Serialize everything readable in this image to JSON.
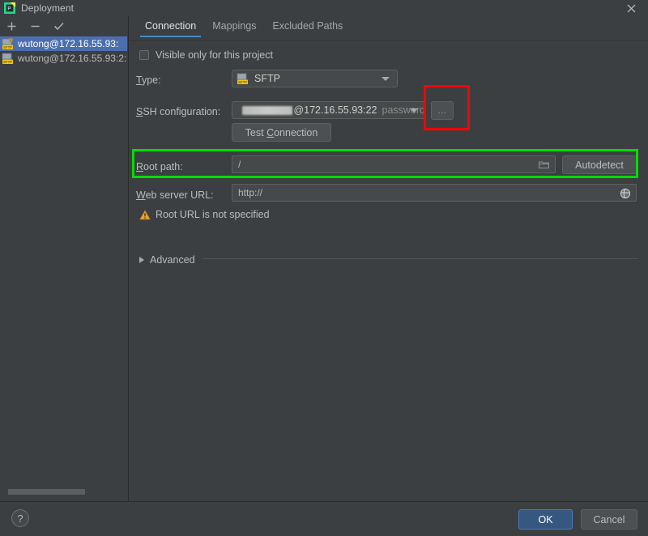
{
  "window": {
    "title": "Deployment",
    "app_icon": "pycharm-icon",
    "close_icon": "close-icon"
  },
  "sidebar": {
    "toolbar": [
      {
        "name": "add-server-button",
        "icon": "plus-icon",
        "label": "+"
      },
      {
        "name": "remove-server-button",
        "icon": "minus-icon",
        "label": "−"
      },
      {
        "name": "set-default-server-button",
        "icon": "check-icon",
        "label": "✓"
      }
    ],
    "servers": [
      {
        "label": "wutong@172.16.55.93:",
        "icon": "sftp-warning-icon",
        "selected": true
      },
      {
        "label": "wutong@172.16.55.93:2:",
        "icon": "sftp-icon",
        "selected": false
      }
    ],
    "scrollbar": "horizontal-scrollbar"
  },
  "tabs": [
    {
      "label": "Connection",
      "active": true
    },
    {
      "label": "Mappings",
      "active": false
    },
    {
      "label": "Excluded Paths",
      "active": false
    }
  ],
  "form": {
    "visible_only_checkbox": {
      "label": "Visible only for this project",
      "checked": false
    },
    "type": {
      "label": "Type:",
      "label_mnemonic": "T",
      "value": "SFTP",
      "icon": "sftp-icon",
      "dropdown_icon": "chevron-down-icon"
    },
    "ssh_configuration": {
      "label": "SSH configuration:",
      "label_mnemonic": "S",
      "value_redacted": true,
      "value_suffix": "@172.16.55.93:22",
      "auth_hint": "password",
      "dropdown_icon": "chevron-down-icon",
      "browse_button_label": "...",
      "browse_button_highlight": "red"
    },
    "test_connection_button": {
      "label": "Test Connection",
      "label_mnemonic": "C"
    },
    "root_path": {
      "label": "Root path:",
      "label_mnemonic": "R",
      "value": "/",
      "folder_icon": "folder-icon",
      "autodetect_label": "Autodetect",
      "row_highlight": "green"
    },
    "web_server_url": {
      "label": "Web server URL:",
      "label_mnemonic": "W",
      "value": "http://",
      "globe_icon": "globe-icon"
    },
    "warning": {
      "icon": "warning-icon",
      "text": "Root URL is not specified"
    },
    "advanced": {
      "label": "Advanced",
      "expanded": false,
      "toggle_icon": "triangle-right-icon"
    }
  },
  "footer": {
    "help_label": "?",
    "ok_label": "OK",
    "cancel_label": "Cancel"
  },
  "colors": {
    "background": "#3c3f41",
    "selection": "#4b6eaf",
    "accent": "#4a88c7",
    "ok_button": "#365880",
    "highlight_red": "#ff0000",
    "highlight_green": "#00dd00",
    "warning": "#e8a33d"
  }
}
